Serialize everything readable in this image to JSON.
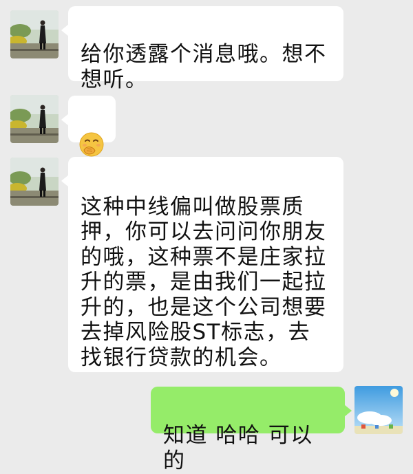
{
  "messages": [
    {
      "sender": "contact",
      "type": "text",
      "text": "给你透露个消息哦。想不\n想听。"
    },
    {
      "sender": "contact",
      "type": "emoji",
      "icon": "hand-over-mouth-emoji"
    },
    {
      "sender": "contact",
      "type": "text",
      "text": "这种中线偏叫做股票质\n押，你可以去问问你朋友\n的哦，这种票不是庄家拉\n升的票，是由我们一起拉\n升的，也是这个公司想要\n去掉风险股ST标志，去\n找银行贷款的机会。"
    },
    {
      "sender": "me",
      "type": "text",
      "text": "知道 哈哈 可以的"
    }
  ],
  "colors": {
    "background": "#ebebeb",
    "incoming_bubble": "#ffffff",
    "outgoing_bubble": "#95ec69"
  }
}
